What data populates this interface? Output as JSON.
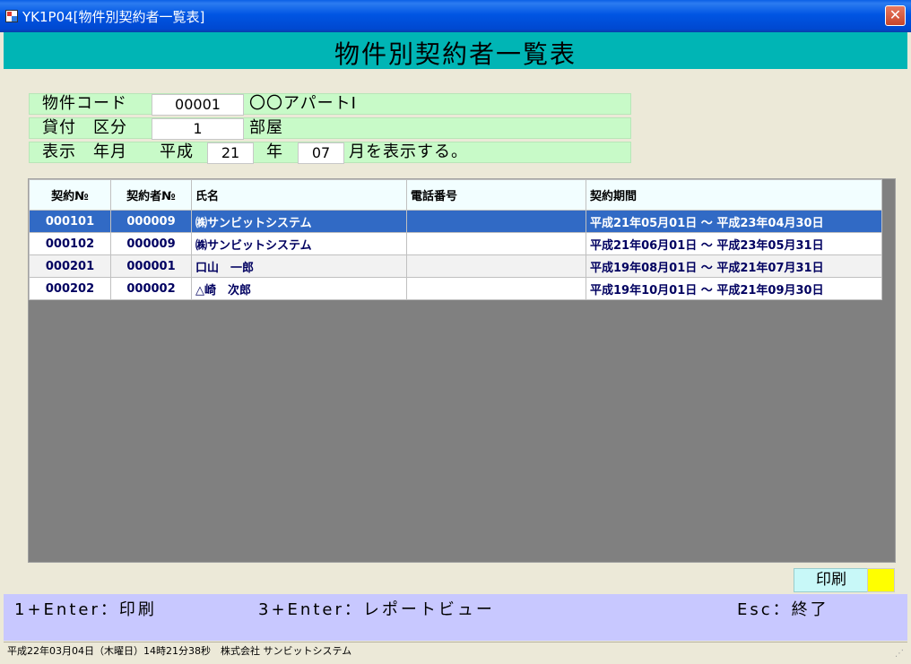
{
  "window": {
    "title": "YK1P04[物件別契約者一覧表]",
    "close_glyph": "✕"
  },
  "page_title": "物件別契約者一覧表",
  "filters": {
    "property_code": {
      "label": "物件コード",
      "value": "00001",
      "name": "〇〇アパートⅠ"
    },
    "loan_type": {
      "label": "貸付　区分",
      "value": "1",
      "name": "部屋"
    },
    "display_ym": {
      "label": "表示　年月",
      "era": "平成",
      "year": "21",
      "year_suffix": "年",
      "month": "07",
      "month_suffix": "月を表示する。"
    }
  },
  "table": {
    "columns": [
      "契約№",
      "契約者№",
      "氏名",
      "電話番号",
      "契約期間"
    ],
    "rows": [
      {
        "contract_no": "000101",
        "contractor_no": "000009",
        "name": "㈱サンビットシステム",
        "phone": "",
        "period": "平成21年05月01日 ～ 平成23年04月30日",
        "selected": true
      },
      {
        "contract_no": "000102",
        "contractor_no": "000009",
        "name": "㈱サンビットシステム",
        "phone": "",
        "period": "平成21年06月01日 ～ 平成23年05月31日",
        "selected": false
      },
      {
        "contract_no": "000201",
        "contractor_no": "000001",
        "name": "口山　一郎",
        "phone": "",
        "period": "平成19年08月01日 ～ 平成21年07月31日",
        "selected": false
      },
      {
        "contract_no": "000202",
        "contractor_no": "000002",
        "name": "△崎　次郎",
        "phone": "",
        "period": "平成19年10月01日 ～ 平成21年09月30日",
        "selected": false
      }
    ]
  },
  "print_button": {
    "label": "印刷",
    "indicator_color": "#FFFF00"
  },
  "function_keys": {
    "f1": "1+Enter：印刷",
    "f3": "3+Enter：レポートビュー",
    "esc": "Esc：終了"
  },
  "status_bar": {
    "text": "平成22年03月04日（木曜日）14時21分38秒　株式会社 サンビットシステム"
  },
  "colors": {
    "header_band": "#00B5B5",
    "filter_bg": "#C8FAC8",
    "selection": "#316AC5",
    "fkey_bg": "#C8C8FF"
  }
}
